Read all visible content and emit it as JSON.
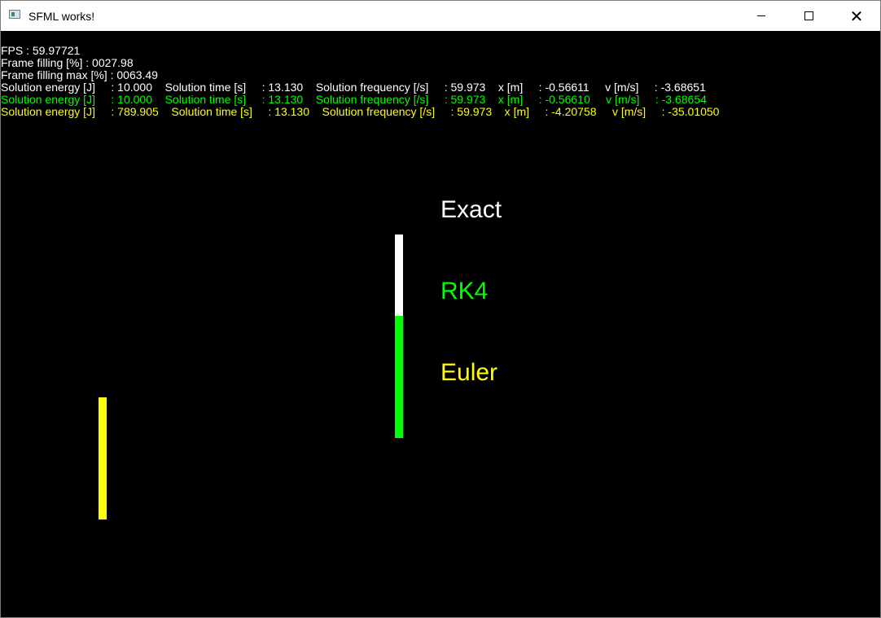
{
  "window": {
    "title": "SFML works!",
    "controls": {
      "minimize": "minimize",
      "maximize": "maximize",
      "close": "✕"
    }
  },
  "colors": {
    "exact": "#ffffff",
    "rk4": "#00ff00",
    "euler": "#ffff00",
    "background": "#000000"
  },
  "stats": {
    "fps": "FPS : 59.97721",
    "frame_filling": "Frame filling [%] : 0027.98",
    "frame_filling_max": "Frame filling max [%] : 0063.49",
    "exact_line": "Solution energy [J]     : 10.000    Solution time [s]     : 13.130    Solution frequency [/s]     : 59.973    x [m]     : -0.56611     v [m/s]     : -3.68651",
    "rk4_line": "Solution energy [J]     : 10.000    Solution time [s]     : 13.130    Solution frequency [/s]     : 59.973    x [m]     : -0.56610     v [m/s]     : -3.68654",
    "euler_line": "Solution energy [J]     : 789.905    Solution time [s]     : 13.130    Solution frequency [/s]     : 59.973    x [m]     : -4.20758     v [m/s]     : -35.01050"
  },
  "labels": {
    "exact": "Exact",
    "rk4": "RK4",
    "euler": "Euler"
  }
}
